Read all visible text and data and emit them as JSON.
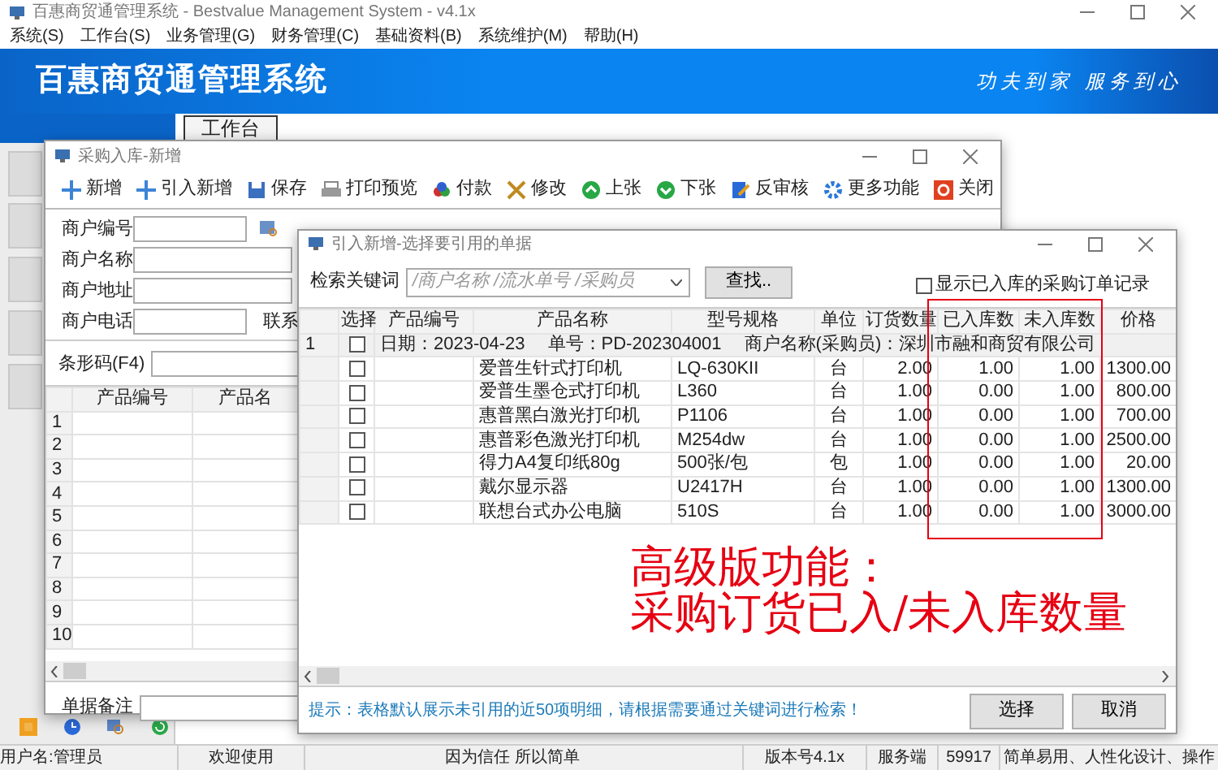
{
  "window": {
    "title": "百惠商贸通管理系统 - Bestvalue Management System - v4.1x"
  },
  "menu": [
    "系统(S)",
    "工作台(S)",
    "业务管理(G)",
    "财务管理(C)",
    "基础资料(B)",
    "系统维护(M)",
    "帮助(H)"
  ],
  "banner": {
    "title": "百惠商贸通管理系统",
    "slogan": "功夫到家 服务到心"
  },
  "workspace_tabs": [
    {
      "label": "工作台",
      "selected": true
    }
  ],
  "purchase_window": {
    "title": "采购入库-新增",
    "toolbar": [
      "新增",
      "引入新增",
      "保存",
      "打印预览",
      "付款",
      "修改",
      "上张",
      "下张",
      "反审核",
      "更多功能",
      "关闭"
    ],
    "fields": [
      {
        "label": "商户编号",
        "kind": "lookup"
      },
      {
        "label": "商户名称",
        "kind": "wide"
      },
      {
        "label": "商户地址",
        "kind": "wide"
      },
      {
        "label": "商户电话",
        "kind": "phone"
      }
    ],
    "contact_label": "联系",
    "barcode_label": "条形码(F4)",
    "grid": {
      "columns": [
        "产品编号",
        "产品名"
      ],
      "rows": [
        "1",
        "2",
        "3",
        "4",
        "5",
        "6",
        "7",
        "8",
        "9",
        "10"
      ]
    },
    "remark_label": "单据备注"
  },
  "dialog": {
    "title": "引入新增-选择要引用的单据",
    "search_label": "检索关键词",
    "search": {
      "placeholder": "/商户名称 /流水单号 /采购员"
    },
    "find_button": "查找..",
    "show_stocked": {
      "label": "显示已入库的采购订单记录",
      "checked": false
    },
    "columns": [
      "选择",
      "产品编号",
      "产品名称",
      "型号规格",
      "单位",
      "订货数量",
      "已入库数",
      "未入库数",
      "价格"
    ],
    "group": {
      "row_number": "1",
      "checked": false,
      "date": "日期：2023-04-23",
      "order_no": "单号：PD-202304001",
      "supplier": "商户名称(采购员)：深圳市融和商贸有限公司"
    },
    "rows": [
      {
        "checked": false,
        "name": "爱普生针式打印机",
        "model": "LQ-630KII",
        "unit": "台",
        "ordered": "2.00",
        "stocked": "1.00",
        "pending": "1.00",
        "price": "1300.00"
      },
      {
        "checked": false,
        "name": "爱普生墨仓式打印机",
        "model": "L360",
        "unit": "台",
        "ordered": "1.00",
        "stocked": "0.00",
        "pending": "1.00",
        "price": "800.00"
      },
      {
        "checked": false,
        "name": "惠普黑白激光打印机",
        "model": "P1106",
        "unit": "台",
        "ordered": "1.00",
        "stocked": "0.00",
        "pending": "1.00",
        "price": "700.00"
      },
      {
        "checked": false,
        "name": "惠普彩色激光打印机",
        "model": "M254dw",
        "unit": "台",
        "ordered": "1.00",
        "stocked": "0.00",
        "pending": "1.00",
        "price": "2500.00"
      },
      {
        "checked": false,
        "name": "得力A4复印纸80g",
        "model": "500张/包",
        "unit": "包",
        "ordered": "1.00",
        "stocked": "0.00",
        "pending": "1.00",
        "price": "20.00"
      },
      {
        "checked": false,
        "name": "戴尔显示器",
        "model": "U2417H",
        "unit": "台",
        "ordered": "1.00",
        "stocked": "0.00",
        "pending": "1.00",
        "price": "1300.00"
      },
      {
        "checked": false,
        "name": "联想台式办公电脑",
        "model": "510S",
        "unit": "台",
        "ordered": "1.00",
        "stocked": "0.00",
        "pending": "1.00",
        "price": "3000.00"
      }
    ],
    "hint": "提示：表格默认展示未引用的近50项明细，请根据需要通过关键词进行检索！",
    "buttons": [
      "选择",
      "取消"
    ]
  },
  "annotation": {
    "lines": [
      "高级版功能：",
      "采购订货已入/未入库数量"
    ]
  },
  "status_bar": [
    "用户名:管理员",
    "欢迎使用",
    "因为信任 所以简单",
    "版本号4.1x",
    "服务端",
    "59917",
    "简单易用、人性化设计、操作"
  ]
}
